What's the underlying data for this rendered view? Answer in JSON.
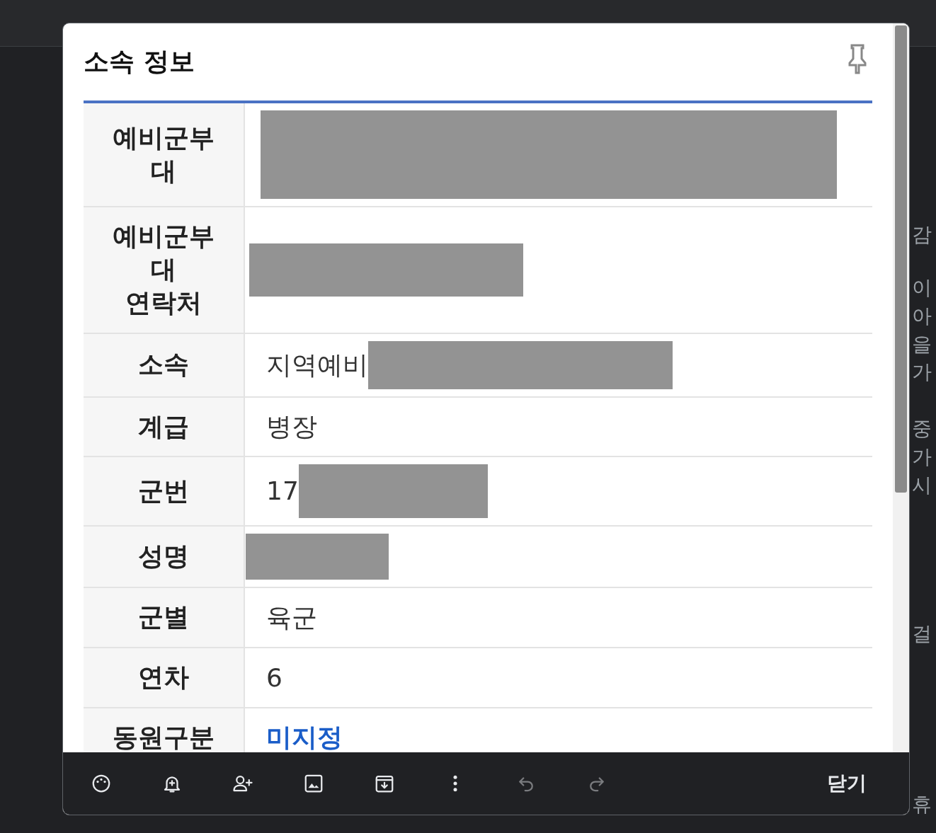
{
  "background": {
    "fragments": [
      "감",
      "이",
      "아",
      "을",
      "가",
      "중",
      "가",
      "시",
      "걸",
      "휴"
    ]
  },
  "dialog": {
    "title": "소속 정보",
    "rows": [
      {
        "label": "예비군부대",
        "value": "",
        "redacted": true
      },
      {
        "label": "예비군부대\n연락처",
        "value": "",
        "redacted": true
      },
      {
        "label": "소속",
        "value": "지역예비",
        "redacted": true
      },
      {
        "label": "계급",
        "value": "병장",
        "redacted": false
      },
      {
        "label": "군번",
        "value": "17",
        "redacted": true
      },
      {
        "label": "성명",
        "value": "",
        "redacted": true
      },
      {
        "label": "군별",
        "value": "육군",
        "redacted": false
      },
      {
        "label": "연차",
        "value": "6",
        "redacted": false
      },
      {
        "label": "동원구분",
        "value": "미지정",
        "redacted": false,
        "kind": "link"
      }
    ]
  },
  "toolbar": {
    "undo": {
      "disabled": true
    },
    "redo": {
      "disabled": true
    },
    "close_label": "닫기"
  }
}
